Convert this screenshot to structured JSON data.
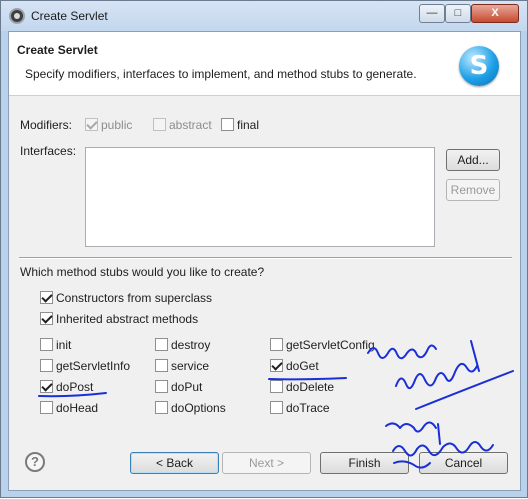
{
  "window": {
    "title": "Create Servlet",
    "minimize": "—",
    "maximize": "□",
    "close": "X"
  },
  "header": {
    "title": "Create Servlet",
    "description": "Specify modifiers, interfaces to implement, and method stubs to generate.",
    "logo_letter": "S"
  },
  "modifiers": {
    "label": "Modifiers:",
    "options": [
      {
        "label": "public",
        "checked": true,
        "enabled": false
      },
      {
        "label": "abstract",
        "checked": false,
        "enabled": false
      },
      {
        "label": "final",
        "checked": false,
        "enabled": true
      }
    ]
  },
  "interfaces": {
    "label": "Interfaces:",
    "add_label": "Add...",
    "remove_label": "Remove"
  },
  "stubs": {
    "question": "Which method stubs would you like to create?",
    "constructors": {
      "label": "Constructors from superclass",
      "checked": true
    },
    "inherited": {
      "label": "Inherited abstract methods",
      "checked": true
    },
    "methods": [
      {
        "label": "init",
        "checked": false
      },
      {
        "label": "destroy",
        "checked": false
      },
      {
        "label": "getServletConfig",
        "checked": false
      },
      {
        "label": "getServletInfo",
        "checked": false
      },
      {
        "label": "service",
        "checked": false
      },
      {
        "label": "doGet",
        "checked": true
      },
      {
        "label": "doPost",
        "checked": true
      },
      {
        "label": "doPut",
        "checked": false
      },
      {
        "label": "doDelete",
        "checked": false
      },
      {
        "label": "doHead",
        "checked": false
      },
      {
        "label": "doOptions",
        "checked": false
      },
      {
        "label": "doTrace",
        "checked": false
      }
    ]
  },
  "footer": {
    "help_icon": "?",
    "back_label": "< Back",
    "next_label": "Next >",
    "finish_label": "Finish",
    "cancel_label": "Cancel"
  },
  "colors": {
    "annotation_ink": "#1a2fd6",
    "logo_blue": "#1ea0e6"
  }
}
